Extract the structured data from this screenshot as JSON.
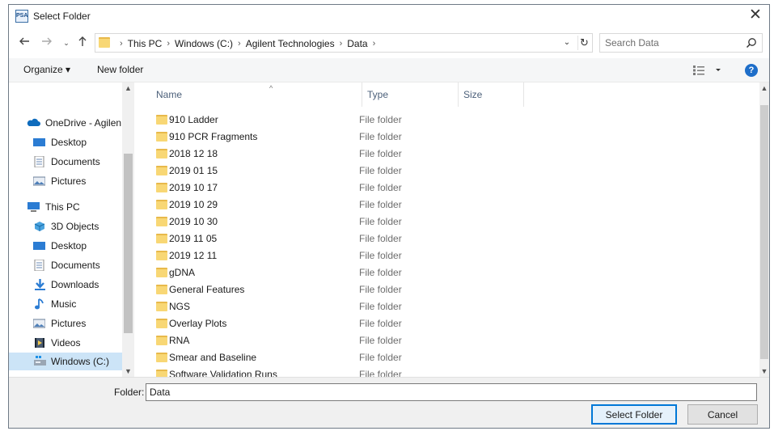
{
  "window": {
    "title": "Select Folder",
    "app_icon_text": "PSA",
    "close_label": "✕"
  },
  "address": {
    "crumbs": [
      "This PC",
      "Windows (C:)",
      "Agilent Technologies",
      "Data"
    ],
    "separator": "›"
  },
  "search": {
    "placeholder": "Search Data"
  },
  "toolbar": {
    "organize_label": "Organize ▾",
    "new_folder_label": "New folder",
    "help_label": "?"
  },
  "nav": {
    "items": [
      {
        "label": "OneDrive - Agilen",
        "icon": "onedrive-icon"
      },
      {
        "label": "Desktop",
        "icon": "desktop-icon"
      },
      {
        "label": "Documents",
        "icon": "documents-icon"
      },
      {
        "label": "Pictures",
        "icon": "pictures-icon"
      },
      {
        "label": "This PC",
        "icon": "pc-icon"
      },
      {
        "label": "3D Objects",
        "icon": "3d-objects-icon"
      },
      {
        "label": "Desktop",
        "icon": "desktop-icon"
      },
      {
        "label": "Documents",
        "icon": "documents-icon"
      },
      {
        "label": "Downloads",
        "icon": "downloads-icon"
      },
      {
        "label": "Music",
        "icon": "music-icon"
      },
      {
        "label": "Pictures",
        "icon": "pictures-icon"
      },
      {
        "label": "Videos",
        "icon": "videos-icon"
      },
      {
        "label": "Windows (C:)",
        "icon": "drive-icon"
      }
    ]
  },
  "columns": {
    "name": "Name",
    "type": "Type",
    "size": "Size"
  },
  "files": [
    {
      "name": "910 Ladder",
      "type": "File folder"
    },
    {
      "name": "910 PCR Fragments",
      "type": "File folder"
    },
    {
      "name": "2018 12 18",
      "type": "File folder"
    },
    {
      "name": "2019 01 15",
      "type": "File folder"
    },
    {
      "name": "2019 10 17",
      "type": "File folder"
    },
    {
      "name": "2019 10 29",
      "type": "File folder"
    },
    {
      "name": "2019 10 30",
      "type": "File folder"
    },
    {
      "name": "2019 11 05",
      "type": "File folder"
    },
    {
      "name": "2019 12 11",
      "type": "File folder"
    },
    {
      "name": "gDNA",
      "type": "File folder"
    },
    {
      "name": "General Features",
      "type": "File folder"
    },
    {
      "name": "NGS",
      "type": "File folder"
    },
    {
      "name": "Overlay Plots",
      "type": "File folder"
    },
    {
      "name": "RNA",
      "type": "File folder"
    },
    {
      "name": "Smear and Baseline",
      "type": "File folder"
    },
    {
      "name": "Software Validation Runs",
      "type": "File folder"
    }
  ],
  "footer": {
    "folder_label": "Folder:",
    "folder_value": "Data",
    "select_label": "Select Folder",
    "cancel_label": "Cancel"
  }
}
